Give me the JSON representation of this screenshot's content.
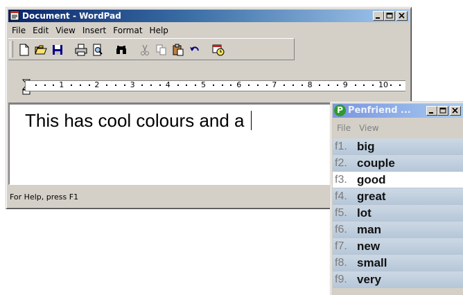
{
  "wordpad": {
    "title": "Document - WordPad",
    "menu": [
      "File",
      "Edit",
      "View",
      "Insert",
      "Format",
      "Help"
    ],
    "toolbar_icons": [
      "new-document-icon",
      "open-folder-icon",
      "save-disk-icon",
      "print-icon",
      "print-preview-icon",
      "find-binoculars-icon",
      "cut-scissors-icon",
      "copy-icon",
      "paste-icon",
      "undo-icon",
      "date-time-icon"
    ],
    "ruler_labels": [
      "1",
      "2",
      "3",
      "4",
      "5",
      "6",
      "7",
      "8",
      "9",
      "10"
    ],
    "document_text": "This has cool colours and a ",
    "status_text": "For Help, press F1"
  },
  "penfriend": {
    "title": "Penfriend ...",
    "menu": [
      "File",
      "View"
    ],
    "suggestions": [
      {
        "key": "f1.",
        "word": "big"
      },
      {
        "key": "f2.",
        "word": "couple"
      },
      {
        "key": "f3.",
        "word": "good"
      },
      {
        "key": "f4.",
        "word": "great"
      },
      {
        "key": "f5.",
        "word": "lot"
      },
      {
        "key": "f6.",
        "word": "man"
      },
      {
        "key": "f7.",
        "word": "new"
      },
      {
        "key": "f8.",
        "word": "small"
      },
      {
        "key": "f9.",
        "word": "very"
      }
    ],
    "selected_index": 2
  },
  "colors": {
    "title_active": "#0a246a",
    "title_inactive": "#7a96df",
    "suggestion_bg": "#c3d2e1",
    "face": "#d4d0c8"
  }
}
